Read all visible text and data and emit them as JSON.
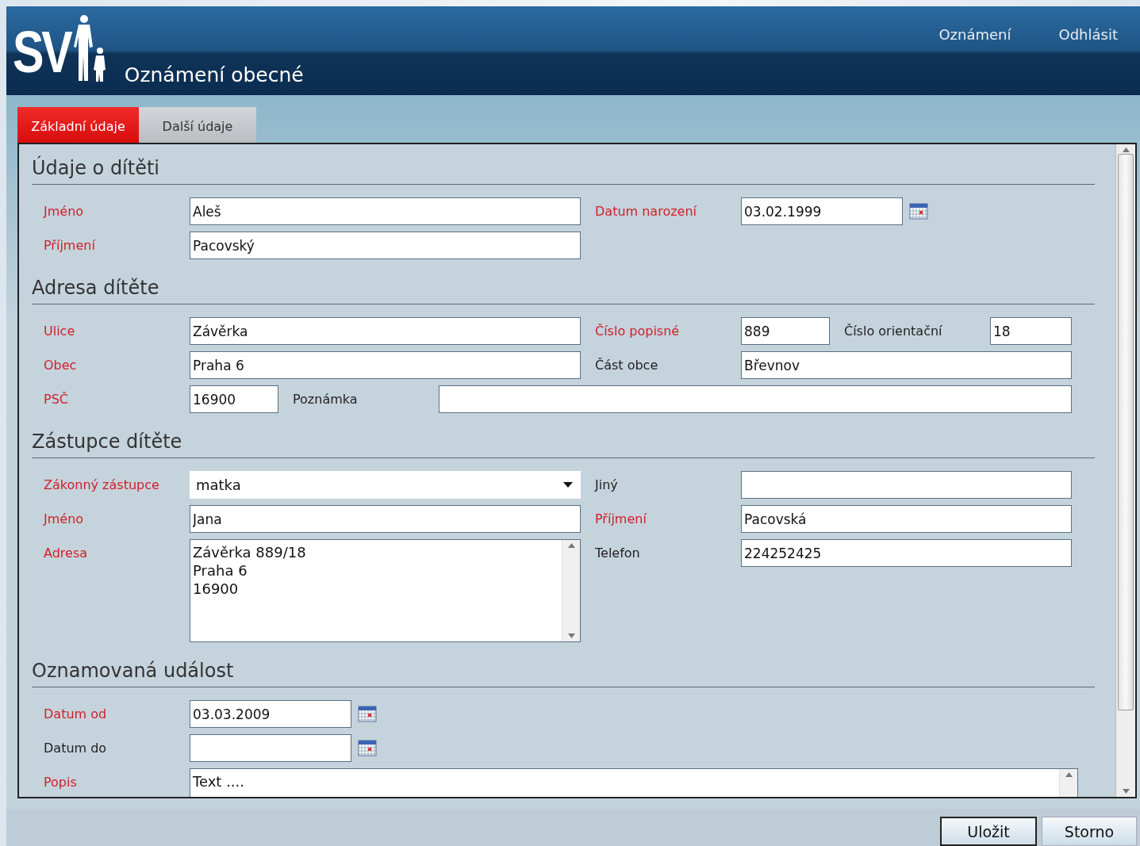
{
  "header": {
    "logo": "SV",
    "title": "Oznámení obecné",
    "nav": [
      "Oznámení",
      "Odhlásit"
    ]
  },
  "tabs": [
    {
      "label": "Základní údaje",
      "selected": true
    },
    {
      "label": "Další údaje",
      "selected": false
    }
  ],
  "sections": [
    {
      "title": "Údaje o dítěti",
      "rows": [
        {
          "fields": [
            {
              "label": "Jméno",
              "required": true,
              "kind": "text",
              "value": "Aleš"
            },
            {
              "label": "Datum narození",
              "required": true,
              "kind": "date",
              "value": "03.02.1999"
            }
          ]
        },
        {
          "fields": [
            {
              "label": "Příjmení",
              "required": true,
              "kind": "text",
              "value": "Pacovský"
            }
          ]
        }
      ]
    },
    {
      "title": "Adresa dítěte",
      "rows": [
        {
          "fields": [
            {
              "label": "Ulice",
              "required": true,
              "kind": "text",
              "value": "Závěrka"
            },
            {
              "label": "Číslo popisné",
              "required": true,
              "kind": "short",
              "value": "889"
            },
            {
              "label": "Číslo orientační",
              "required": false,
              "kind": "short",
              "value": "18"
            }
          ]
        },
        {
          "fields": [
            {
              "label": "Obec",
              "required": true,
              "kind": "text",
              "value": "Praha 6"
            },
            {
              "label": "Část obce",
              "required": false,
              "kind": "text",
              "value": "Břevnov"
            }
          ]
        },
        {
          "fields": [
            {
              "label": "PSČ",
              "required": true,
              "kind": "short",
              "value": "16900"
            },
            {
              "label": "Poznámka",
              "required": false,
              "kind": "text"
            }
          ]
        }
      ]
    },
    {
      "title": "Zástupce dítěte",
      "rows": [
        {
          "fields": [
            {
              "label": "Zákonný zástupce",
              "required": true,
              "kind": "select",
              "value": "matka"
            },
            {
              "label": "Jiný",
              "required": false,
              "kind": "text"
            }
          ]
        },
        {
          "fields": [
            {
              "label": "Jméno",
              "required": true,
              "kind": "text",
              "value": "Jana"
            },
            {
              "label": "Příjmení",
              "required": true,
              "kind": "text",
              "value": "Pacovská"
            }
          ]
        },
        {
          "fields": [
            {
              "label": "Adresa",
              "required": true,
              "kind": "textarea",
              "value": "Závěrka 889/18\nPraha 6\n16900"
            },
            {
              "label": "Telefon",
              "required": false,
              "kind": "text",
              "value": "224252425"
            }
          ]
        }
      ]
    },
    {
      "title": "Oznamovaná událost",
      "rows": [
        {
          "fields": [
            {
              "label": "Datum od",
              "required": true,
              "kind": "date",
              "value": "03.03.2009"
            }
          ]
        },
        {
          "fields": [
            {
              "label": "Datum do",
              "required": false,
              "kind": "date"
            }
          ]
        },
        {
          "fields": [
            {
              "label": "Popis",
              "required": true,
              "kind": "memo",
              "value": "Text ...."
            }
          ]
        }
      ]
    }
  ],
  "buttons": [
    {
      "label": "Uložit",
      "default": true
    },
    {
      "label": "Storno",
      "default": false
    }
  ]
}
